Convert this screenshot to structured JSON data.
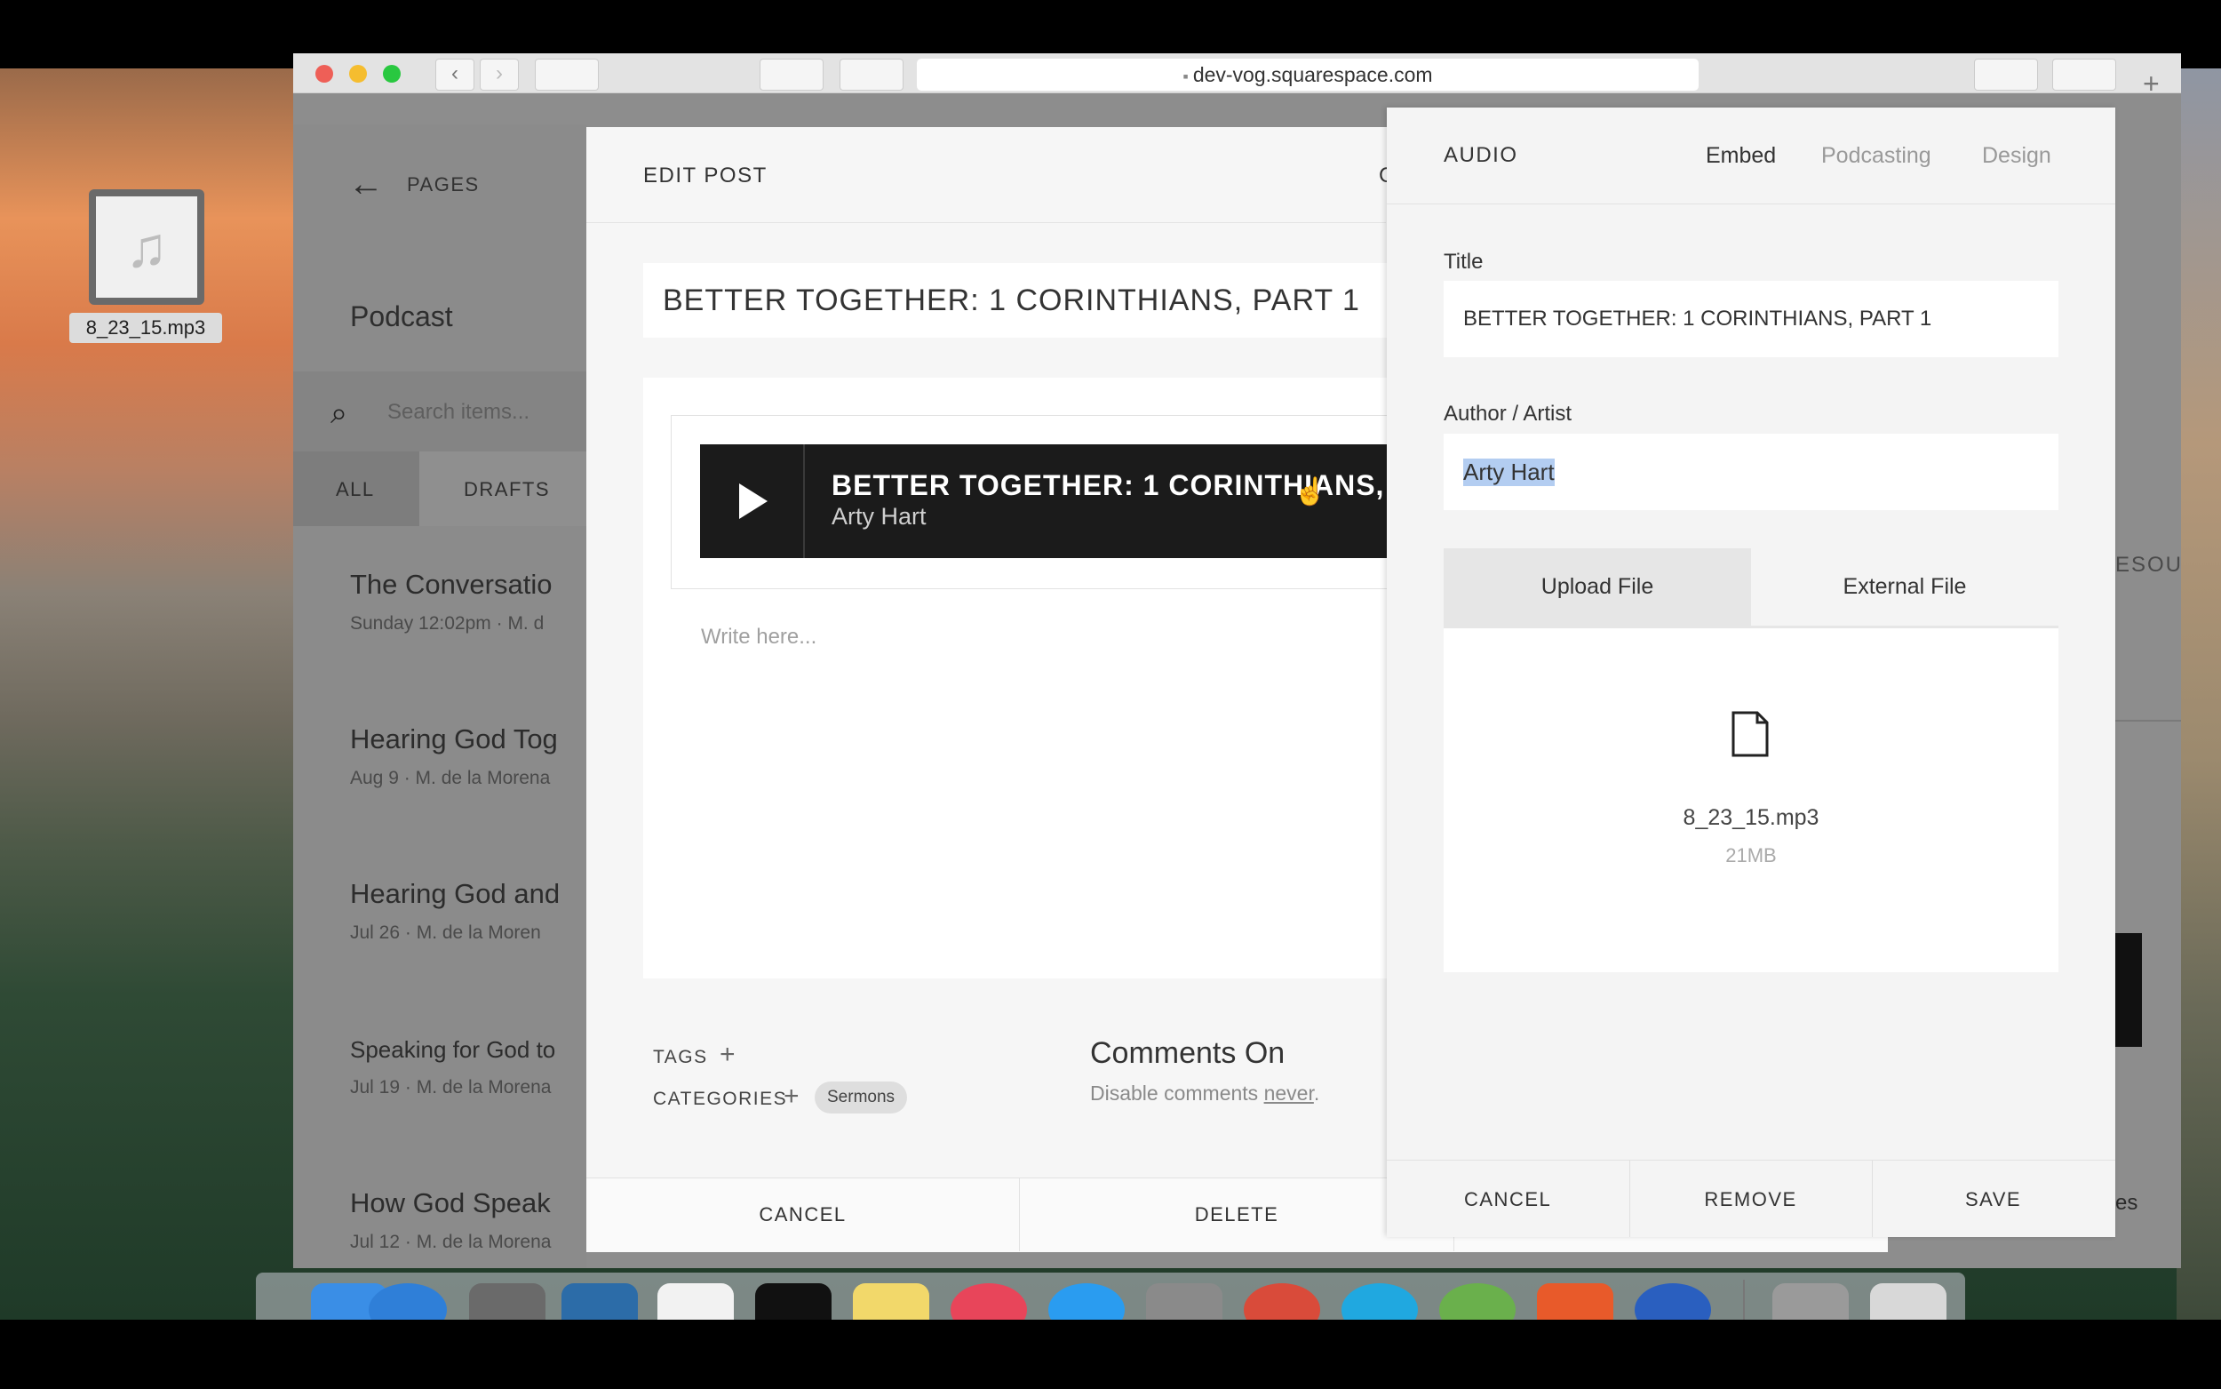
{
  "desktop": {
    "file_name": "8_23_15.mp3"
  },
  "browser": {
    "url": "dev-vog.squarespace.com"
  },
  "pages_panel": {
    "back_label": "PAGES",
    "section_title": "Podcast",
    "search_placeholder": "Search items...",
    "filters": [
      "ALL",
      "DRAFTS"
    ],
    "items": [
      {
        "title": "The Conversatio",
        "meta": "Sunday 12:02pm  ·  M. d"
      },
      {
        "title": "Hearing God Tog",
        "meta": "Aug 9  ·  M. de la Morena"
      },
      {
        "title": "Hearing God and",
        "meta": "Jul 26  ·  M. de la Moren"
      },
      {
        "title": "Speaking for God to",
        "meta": "Jul 19  ·  M. de la Morena"
      },
      {
        "title": "How God Speak",
        "meta": "Jul 12  ·  M. de la Morena"
      }
    ],
    "right_fragment_1": "ESOU",
    "right_fragment_2": "es"
  },
  "edit_post": {
    "header": "EDIT POST",
    "header_fragment": "C",
    "title_value": "BETTER TOGETHER: 1 CORINTHIANS, PART 1",
    "audio_title": "BETTER TOGETHER: 1 CORINTHIANS,",
    "audio_artist": "Arty Hart",
    "body_placeholder": "Write here...",
    "tags_label": "TAGS",
    "categories_label": "CATEGORIES",
    "category_chip": "Sermons",
    "comments_title": "Comments On",
    "comments_desc_prefix": "Disable comments ",
    "comments_link": "never",
    "comments_desc_suffix": ".",
    "cancel_label": "CANCEL",
    "delete_label": "DELETE"
  },
  "audio_panel": {
    "header": "AUDIO",
    "tabs": [
      "Embed",
      "Podcasting",
      "Design"
    ],
    "title_label": "Title",
    "title_value": "BETTER TOGETHER: 1 CORINTHIANS, PART 1",
    "author_label": "Author / Artist",
    "author_value": "Arty Hart",
    "upload_tab": "Upload File",
    "external_tab": "External File",
    "file_name": "8_23_15.mp3",
    "file_size": "21MB",
    "cancel_label": "CANCEL",
    "remove_label": "REMOVE",
    "save_label": "SAVE"
  },
  "colors": {
    "accent_selection": "#b3cdf1",
    "player_bg": "#1b1b1b"
  }
}
